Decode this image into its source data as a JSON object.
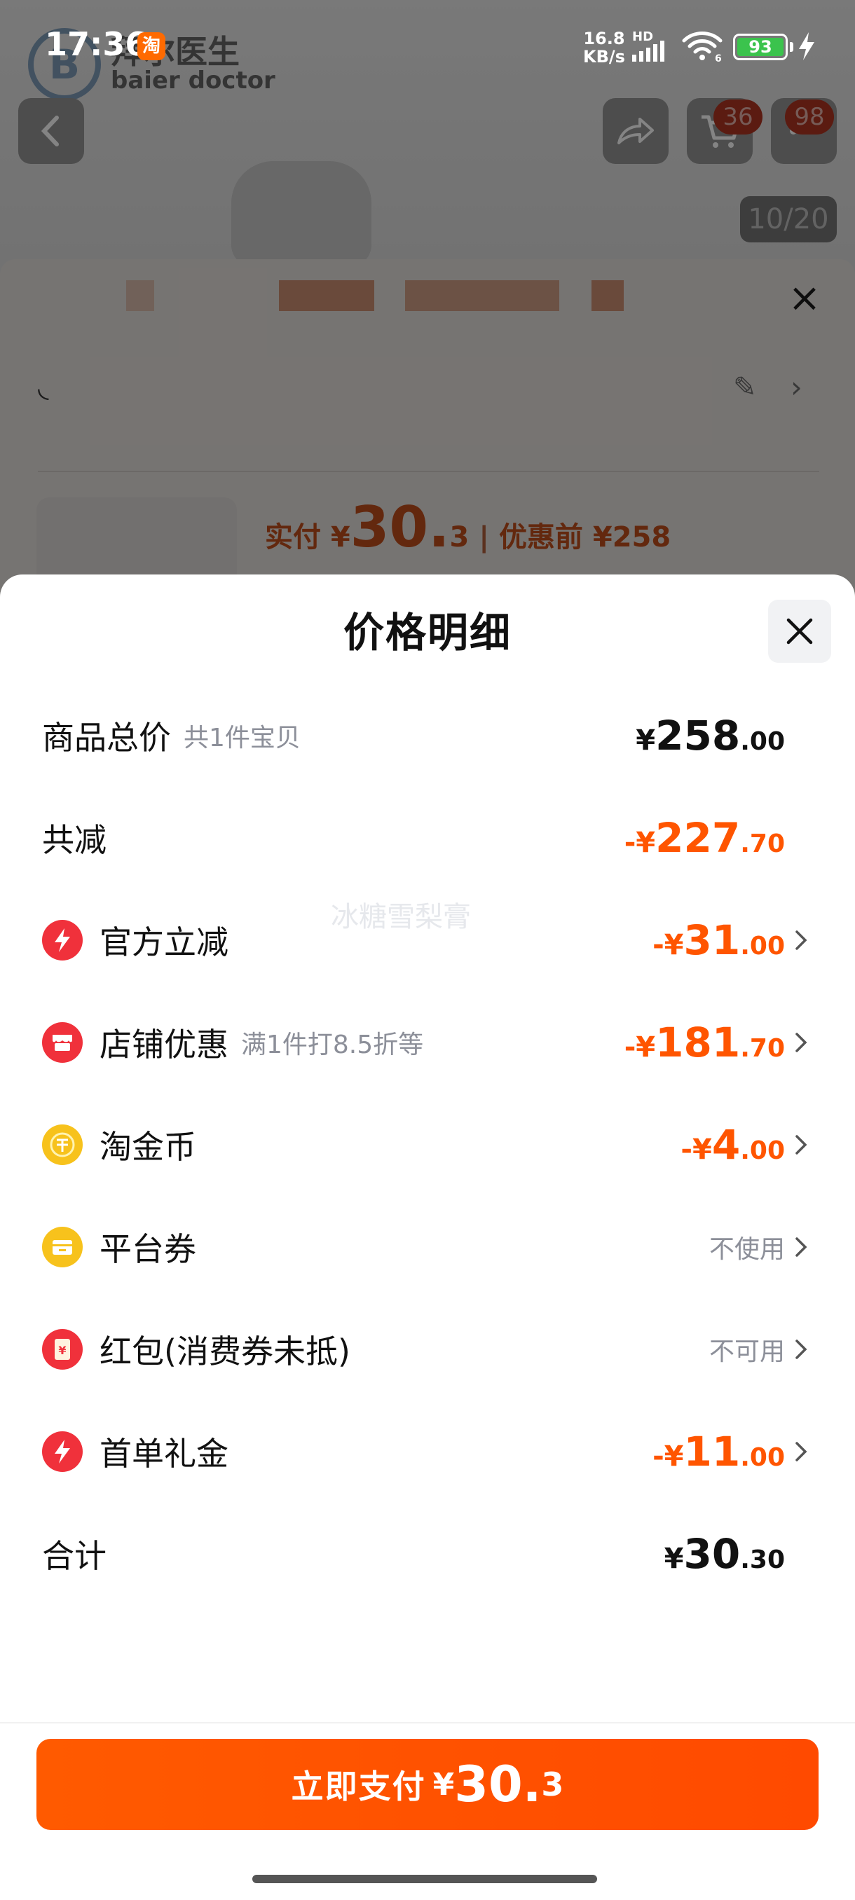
{
  "status_bar": {
    "time": "17:36",
    "taobao_badge": "淘",
    "net_speed_value": "16.8",
    "net_speed_unit": "KB/s",
    "signal_label": "HD",
    "wifi_label": "6",
    "battery": "93"
  },
  "background": {
    "brand_mark": "B",
    "brand_name": "拜尔医生",
    "brand_name_en": "baier doctor",
    "cart_badge": "36",
    "msg_badge": "98",
    "image_counter": "10/20",
    "paid_prefix": "实付 ¥",
    "paid_int": "30.",
    "paid_dec": "3",
    "sep": "|",
    "original_price": "优惠前 ¥258"
  },
  "sheet": {
    "title": "价格明细",
    "rows": [
      {
        "label": "商品总价",
        "sub": "共1件宝贝",
        "currency": "¥",
        "int": "258",
        "dec": ".00",
        "tone": "dark"
      },
      {
        "label": "共减",
        "sub": "",
        "currency": "-¥",
        "int": "227",
        "dec": ".70",
        "tone": "orange"
      },
      {
        "label": "官方立减",
        "sub": "",
        "currency": "-¥",
        "int": "31",
        "dec": ".00",
        "tone": "orange"
      },
      {
        "label": "店铺优惠",
        "sub": "满1件打8.5折等",
        "currency": "-¥",
        "int": "181",
        "dec": ".70",
        "tone": "orange"
      },
      {
        "label": "淘金币",
        "sub": "",
        "currency": "-¥",
        "int": "4",
        "dec": ".00",
        "tone": "orange"
      },
      {
        "label": "平台券",
        "sub": "",
        "status": "不使用"
      },
      {
        "label": "红包(消费券未抵)",
        "sub": "",
        "status": "不可用"
      },
      {
        "label": "首单礼金",
        "sub": "",
        "currency": "-¥",
        "int": "11",
        "dec": ".00",
        "tone": "orange"
      },
      {
        "label": "合计",
        "sub": "",
        "currency": "¥",
        "int": "30",
        "dec": ".30",
        "tone": "dark"
      }
    ],
    "watermark": "冰糖雪梨膏"
  },
  "pay_button": {
    "label": "立即支付",
    "currency": "¥",
    "int": "30.",
    "dec": "3"
  },
  "colors": {
    "accent": "#ff5500",
    "red_icon": "#f0313b",
    "gold_icon": "#f7c21c"
  },
  "icons": {
    "official": "lightning-icon",
    "store": "store-icon",
    "coin": "gold-coin-icon",
    "coupon": "coupon-icon",
    "redpacket": "red-packet-icon",
    "firstorder": "lightning-icon"
  }
}
